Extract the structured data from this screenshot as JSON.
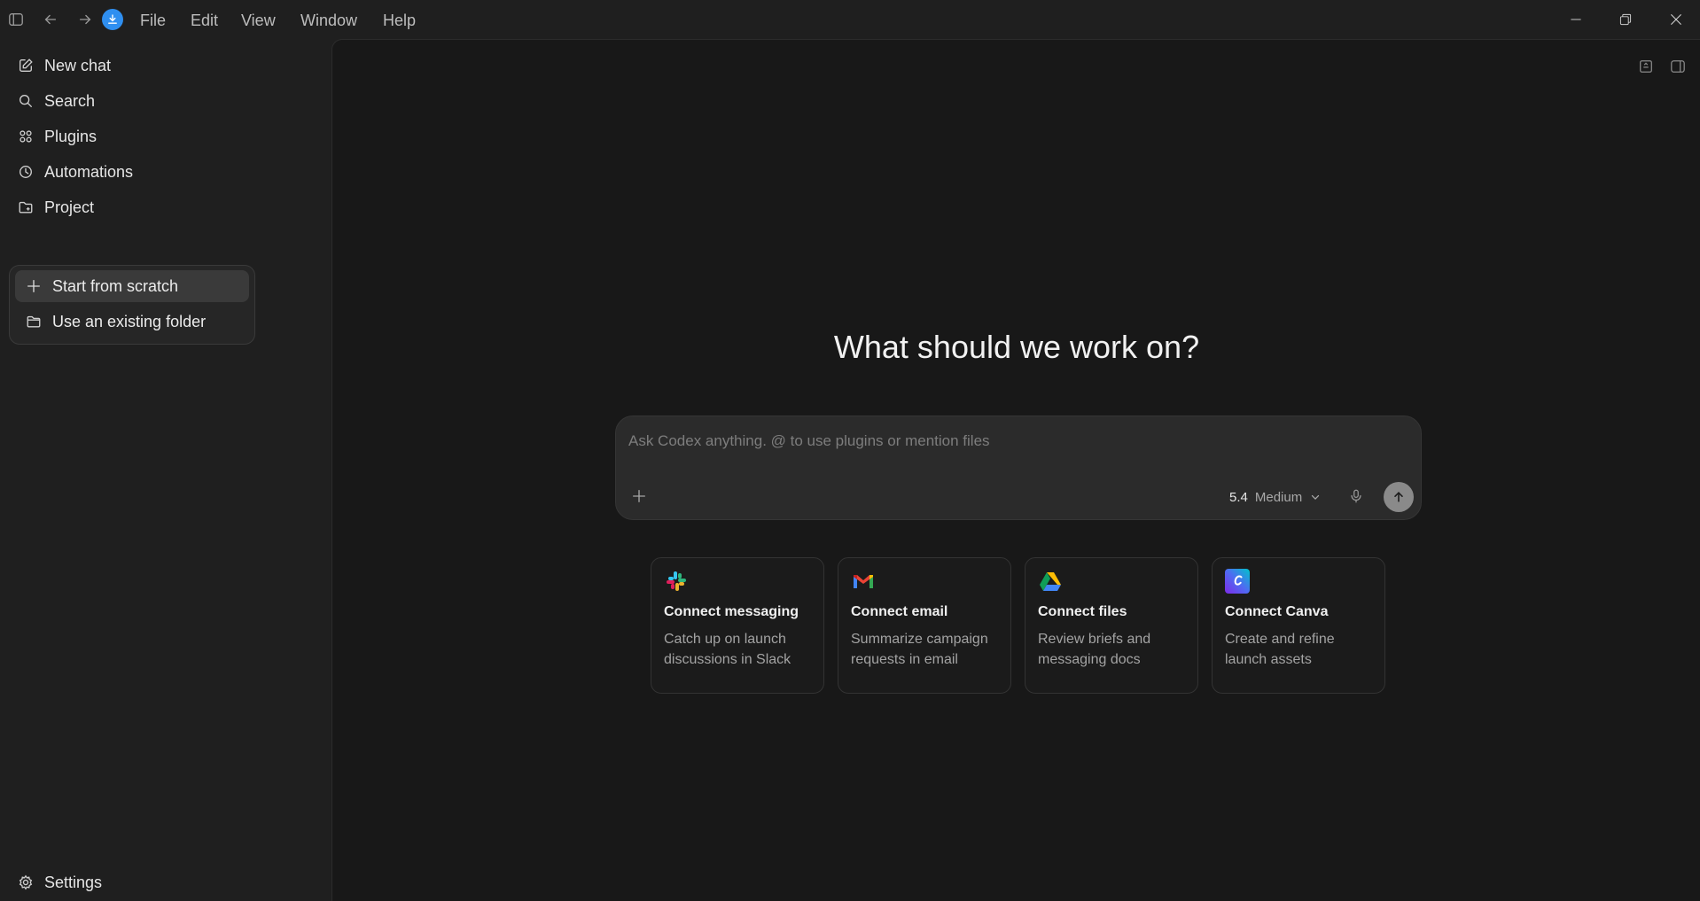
{
  "menubar": {
    "items": [
      "File",
      "Edit",
      "View",
      "Window",
      "Help"
    ]
  },
  "sidebar": {
    "items": [
      {
        "label": "New chat",
        "icon": "edit-icon"
      },
      {
        "label": "Search",
        "icon": "search-icon"
      },
      {
        "label": "Plugins",
        "icon": "grid-icon"
      },
      {
        "label": "Automations",
        "icon": "clock-icon"
      },
      {
        "label": "Project",
        "icon": "folder-plus-icon"
      }
    ],
    "project_menu": [
      {
        "label": "Start from scratch",
        "icon": "plus-icon"
      },
      {
        "label": "Use an existing folder",
        "icon": "folder-icon"
      }
    ],
    "settings_label": "Settings"
  },
  "main": {
    "headline": "What should we work on?",
    "composer": {
      "placeholder": "Ask Codex anything. @ to use plugins or mention files",
      "model_version": "5.4",
      "reasoning_level": "Medium"
    },
    "cards": [
      {
        "title": "Connect messaging",
        "description": "Catch up on launch discussions in Slack",
        "icon": "slack-icon"
      },
      {
        "title": "Connect email",
        "description": "Summarize campaign requests in email",
        "icon": "gmail-icon"
      },
      {
        "title": "Connect files",
        "description": "Review briefs and messaging docs",
        "icon": "google-drive-icon"
      },
      {
        "title": "Connect Canva",
        "description": "Create and refine launch assets",
        "icon": "canva-icon"
      }
    ]
  },
  "colors": {
    "accent": "#2f8ff0",
    "background": "#181818",
    "sidebar_bg": "#1f1f1f"
  }
}
